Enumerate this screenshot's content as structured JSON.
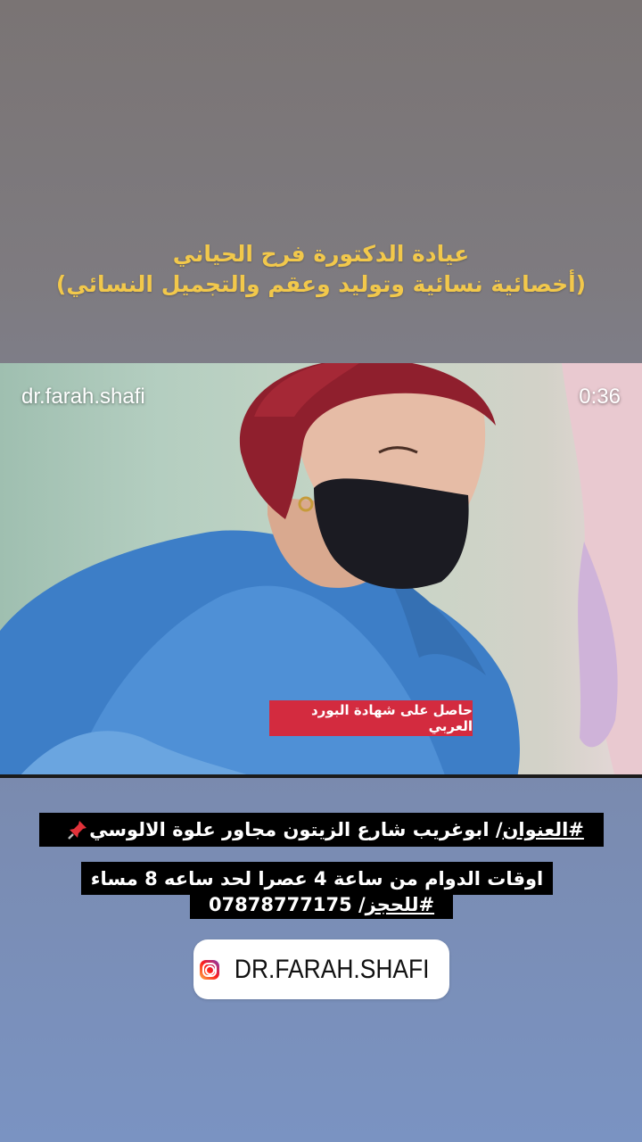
{
  "headline": {
    "line1": "عيادة الدكتورة فرح الحياني",
    "line2": "(أخصائية نسائية وتوليد وعقم والتجميل النسائي)",
    "color": "#f2c84b"
  },
  "video": {
    "handle": "dr.farah.shafi",
    "duration": "0:36",
    "caption": "حاصل على شهادة البورد العربي",
    "caption_color": "#d32b3f"
  },
  "address": {
    "hashtag": "#العنوان",
    "text": " / ابوغريب شارع الزيتون مجاور علوة الالوسي ",
    "icon": "pushpin-icon"
  },
  "hours": {
    "text": "اوقات الدوام من ساعة 4 عصرا لحد ساعه 8 مساء"
  },
  "booking": {
    "hashtag": "#للحجز",
    "text": " / 07878777175"
  },
  "mention": {
    "icon": "instagram-icon",
    "text": "DR.FARAH.SHAFI"
  }
}
